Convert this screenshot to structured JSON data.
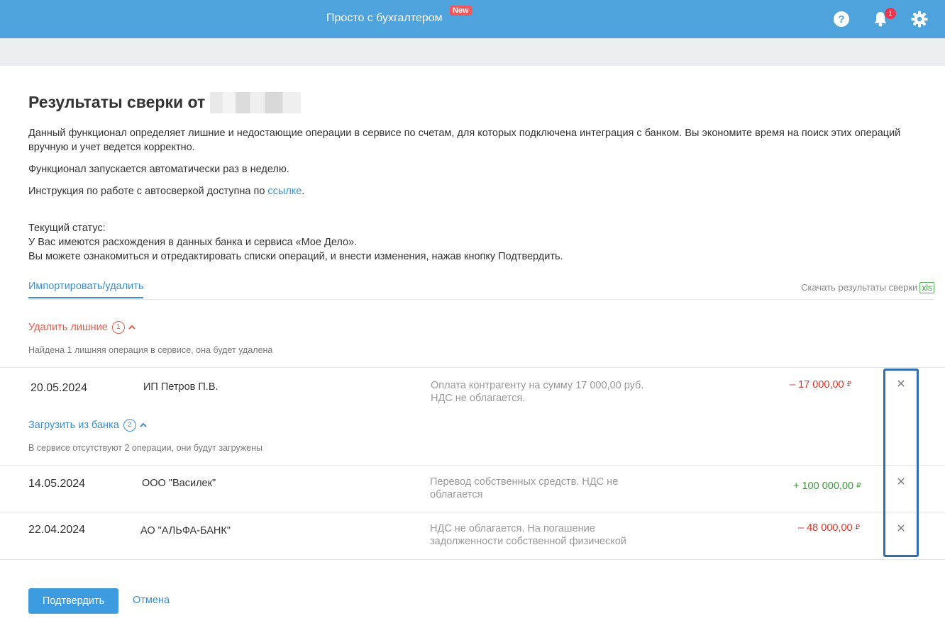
{
  "header": {
    "brand": "Просто с бухгалтером",
    "new_badge": "New",
    "notification_count": "1",
    "icons": [
      "help-icon",
      "bell-icon",
      "gear-icon"
    ],
    "color": "#4fa3dc"
  },
  "page": {
    "title": "Результаты сверки от",
    "intro": "Данный функционал определяет лишние и недостающие операции в сервисе по счетам, для которых подключена интеграция с банком. Вы экономите время на поиск этих операций вручную и учет ведется корректно.",
    "auto_run": "Функционал запускается автоматически раз в неделю.",
    "instruction_prefix": "Инструкция по работе с автосверкой доступна по ",
    "instruction_link": "ссылке",
    "instruction_suffix": ".",
    "status_label": "Текущий статус:",
    "status_line1": "У Вас имеются расхождения в данных банка и сервиса «Мое Дело».",
    "status_line2": "Вы можете ознакомиться и отредактировать списки операций, и внести изменения, нажав кнопку Подтвердить."
  },
  "tabs": {
    "active": "Импортировать/удалить",
    "download_label": "Скачать результаты сверки",
    "download_badge": "xls"
  },
  "delete_section": {
    "title": "Удалить лишние",
    "count": "1",
    "note": "Найдена 1 лишняя операция в сервисе, она будет удалена",
    "rows": [
      {
        "date": "20.05.2024",
        "party": "ИП Петров П.В.",
        "desc": "Оплата контрагенту на сумму 17 000,00 руб. НДС не облагается.",
        "amount": "– 17 000,00",
        "currency": "₽",
        "direction": "out"
      }
    ]
  },
  "load_section": {
    "title": "Загрузить из банка",
    "count": "2",
    "note": "В сервисе отсутствуют 2 операции, они будут загружены",
    "rows": [
      {
        "date": "14.05.2024",
        "party": "ООО \"Василек\"",
        "desc": "Перевод собственных средств. НДС не облагается",
        "amount": "+ 100 000,00",
        "currency": "₽",
        "direction": "in"
      },
      {
        "date": "22.04.2024",
        "party": "АО \"АЛЬФА-БАНК\"",
        "desc": "НДС не облагается. На погашение задолженности собственной физической",
        "amount": "– 48 000,00",
        "currency": "₽",
        "direction": "out"
      }
    ]
  },
  "actions": {
    "confirm": "Подтвердить",
    "cancel": "Отмена"
  },
  "colors": {
    "accent": "#3d8fd1",
    "negative": "#d9372c",
    "positive": "#3c9a3c",
    "delete_heading": "#e85c4a",
    "highlight": "#2e6db0"
  }
}
